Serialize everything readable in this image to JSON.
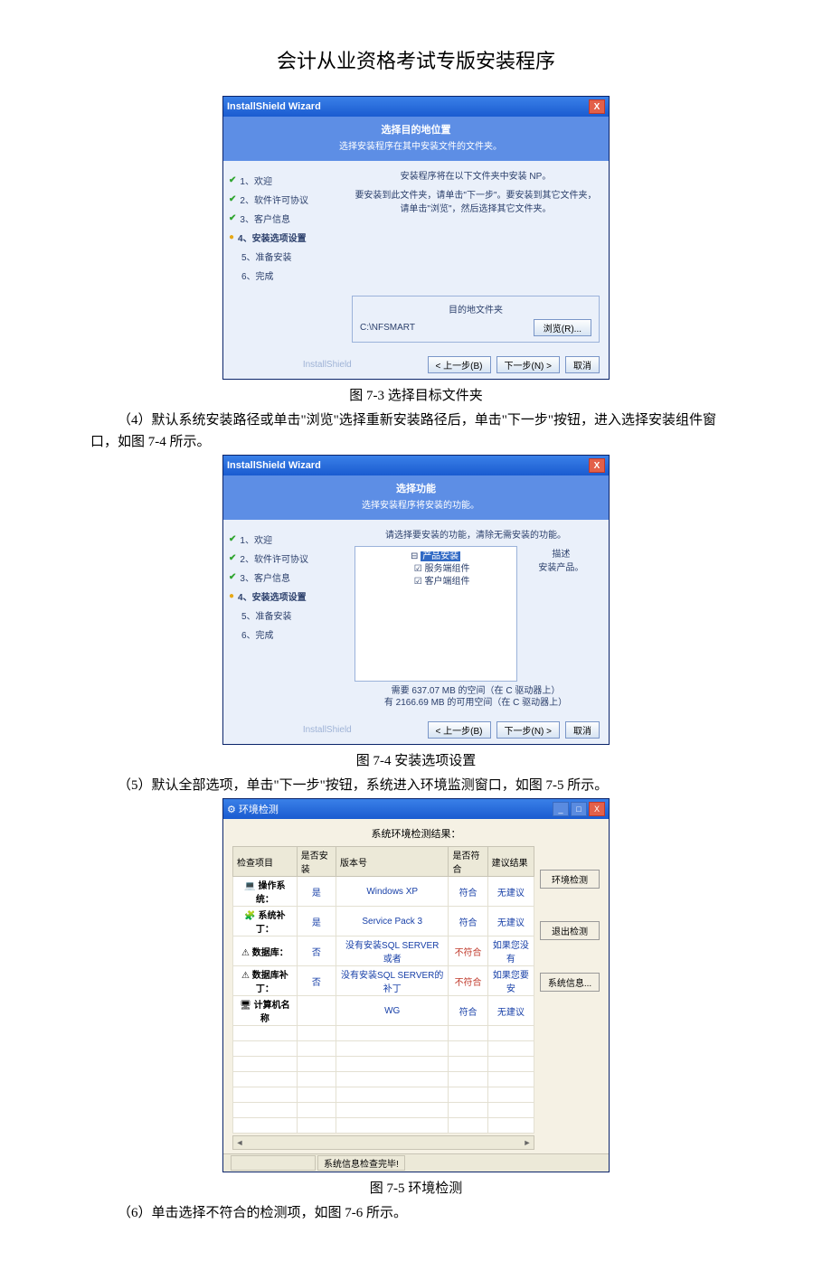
{
  "doc": {
    "title": "会计从业资格考试专版安装程序",
    "caption1": "图 7-3  选择目标文件夹",
    "para1": "（4）默认系统安装路径或单击\"浏览\"选择重新安装路径后，单击\"下一步\"按钮，进入选择安装组件窗口，如图 7-4 所示。",
    "caption2": "图 7-4  安装选项设置",
    "para2": "（5）默认全部选项，单击\"下一步\"按钮，系统进入环境监测窗口，如图 7-5 所示。",
    "caption3": "图 7-5  环境检测",
    "para3": "（6）单击选择不符合的检测项，如图 7-6 所示。"
  },
  "wiz": {
    "window_title": "InstallShield Wizard",
    "close": "X",
    "brand": "InstallShield",
    "steps": {
      "s1": "1、欢迎",
      "s2": "2、软件许可协议",
      "s3": "3、客户信息",
      "s4": "4、安装选项设置",
      "s5": "5、准备安装",
      "s6": "6、完成"
    },
    "buttons": {
      "back": "< 上一步(B)",
      "next": "下一步(N) >",
      "cancel": "取消"
    }
  },
  "wiz1": {
    "h1": "选择目的地位置",
    "h2": "选择安装程序在其中安装文件的文件夹。",
    "msg1": "安装程序将在以下文件夹中安装 NP。",
    "msg2": "要安装到此文件夹，请单击\"下一步\"。要安装到其它文件夹，请单击\"浏览\"，然后选择其它文件夹。",
    "dest_label": "目的地文件夹",
    "dest_path": "C:\\NFSMART",
    "browse": "浏览(R)..."
  },
  "wiz2": {
    "h1": "选择功能",
    "h2": "选择安装程序将安装的功能。",
    "msg": "请选择要安装的功能，清除无需安装的功能。",
    "desc_title": "描述",
    "desc_body": "安装产品。",
    "tree_root": "产品安装",
    "tree_c1": "服务端组件",
    "tree_c2": "客户端组件",
    "disk1": "需要 637.07 MB 的空间（在 C 驱动器上）",
    "disk2": "有 2166.69 MB 的可用空间（在 C 驱动器上）"
  },
  "env": {
    "title": "环境检测",
    "label": "系统环境检测结果：",
    "headers": {
      "item": "检查项目",
      "installed": "是否安装",
      "version": "版本号",
      "match": "是否符合",
      "suggest": "建议结果"
    },
    "rows": [
      {
        "icon": "💻",
        "item": "操作系统：",
        "installed": "是",
        "version": "Windows XP",
        "match": "符合",
        "suggest": "无建议",
        "match_red": false
      },
      {
        "icon": "🧩",
        "item": "系统补丁：",
        "installed": "是",
        "version": "Service Pack 3",
        "match": "符合",
        "suggest": "无建议",
        "match_red": false
      },
      {
        "icon": "⚠",
        "item": "数据库：",
        "installed": "否",
        "version": "没有安装SQL SERVER 或者",
        "match": "不符合",
        "suggest": "如果您没有",
        "match_red": true
      },
      {
        "icon": "⚠",
        "item": "数据库补丁：",
        "installed": "否",
        "version": "没有安装SQL SERVER的补丁",
        "match": "不符合",
        "suggest": "如果您要安",
        "match_red": true
      },
      {
        "icon": "🖥",
        "item": "计算机名称",
        "installed": "",
        "version": "WG",
        "match": "符合",
        "suggest": "无建议",
        "match_red": false
      }
    ],
    "btn_check": "环境检测",
    "btn_exit": "退出检测",
    "btn_sysinfo": "系统信息...",
    "status": "系统信息检查完毕!",
    "min": "_",
    "max": "□",
    "close": "X"
  }
}
